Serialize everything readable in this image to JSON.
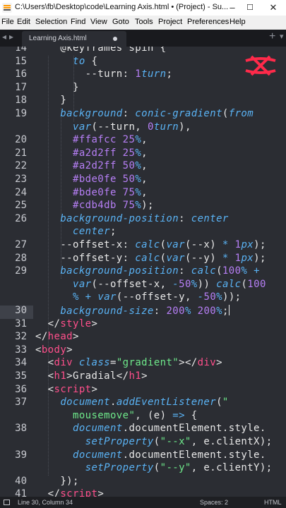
{
  "window": {
    "title": "C:\\Users\\fb\\Desktop\\code\\Learning Axis.html • (Project) - Su...",
    "minimize": "–",
    "maximize": "☐",
    "close": "✕"
  },
  "menu": [
    "File",
    "Edit",
    "Selection",
    "Find",
    "View",
    "Goto",
    "Tools",
    "Project",
    "Preferences",
    "Help"
  ],
  "tabs": {
    "nav_left": "◂",
    "nav_right": "▸",
    "active_label": "Learning Axis.html",
    "new_tab": "+",
    "overflow": "▾"
  },
  "colors": {
    "background": "#2b2d33",
    "text": "#e8e8e8",
    "keyword": "#5ab3f5",
    "selector": "#ff4f8b",
    "string": "#6ee88a",
    "number": "#b67ff5",
    "logo": "#ff2a4a"
  },
  "current_line": 30,
  "editor": {
    "lines": [
      {
        "n": 14,
        "segs": [
          [
            "t",
            "    @keyframes spin {"
          ]
        ]
      },
      {
        "n": 15,
        "segs": [
          [
            "t",
            "      "
          ],
          [
            "k",
            "to"
          ],
          [
            "t",
            " {"
          ]
        ]
      },
      {
        "n": 16,
        "segs": [
          [
            "t",
            "        --turn: "
          ],
          [
            "m",
            "1"
          ],
          [
            "k",
            "turn"
          ],
          [
            "t",
            ";"
          ]
        ]
      },
      {
        "n": 17,
        "segs": [
          [
            "t",
            "      }"
          ]
        ]
      },
      {
        "n": 18,
        "segs": [
          [
            "t",
            "    }"
          ]
        ]
      },
      {
        "n": 19,
        "segs": [
          [
            "t",
            "    "
          ],
          [
            "p",
            "background"
          ],
          [
            "t",
            ": "
          ],
          [
            "k",
            "conic-gradient"
          ],
          [
            "t",
            "("
          ],
          [
            "k",
            "from"
          ]
        ]
      },
      {
        "n": null,
        "segs": [
          [
            "t",
            "      "
          ],
          [
            "k",
            "var"
          ],
          [
            "t",
            "(--turn, "
          ],
          [
            "m",
            "0"
          ],
          [
            "k",
            "turn"
          ],
          [
            "t",
            "),"
          ]
        ]
      },
      {
        "n": 20,
        "segs": [
          [
            "t",
            "      "
          ],
          [
            "m",
            "#ffafcc"
          ],
          [
            "t",
            " "
          ],
          [
            "m",
            "25"
          ],
          [
            "k",
            "%"
          ],
          [
            "t",
            ","
          ]
        ]
      },
      {
        "n": 21,
        "segs": [
          [
            "t",
            "      "
          ],
          [
            "m",
            "#a2d2ff"
          ],
          [
            "t",
            " "
          ],
          [
            "m",
            "25"
          ],
          [
            "k",
            "%"
          ],
          [
            "t",
            ","
          ]
        ]
      },
      {
        "n": 22,
        "segs": [
          [
            "t",
            "      "
          ],
          [
            "m",
            "#a2d2ff"
          ],
          [
            "t",
            " "
          ],
          [
            "m",
            "50"
          ],
          [
            "k",
            "%"
          ],
          [
            "t",
            ","
          ]
        ]
      },
      {
        "n": 23,
        "segs": [
          [
            "t",
            "      "
          ],
          [
            "m",
            "#bde0fe"
          ],
          [
            "t",
            " "
          ],
          [
            "m",
            "50"
          ],
          [
            "k",
            "%"
          ],
          [
            "t",
            ","
          ]
        ]
      },
      {
        "n": 24,
        "segs": [
          [
            "t",
            "      "
          ],
          [
            "m",
            "#bde0fe"
          ],
          [
            "t",
            " "
          ],
          [
            "m",
            "75"
          ],
          [
            "k",
            "%"
          ],
          [
            "t",
            ","
          ]
        ]
      },
      {
        "n": 25,
        "segs": [
          [
            "t",
            "      "
          ],
          [
            "m",
            "#cdb4db"
          ],
          [
            "t",
            " "
          ],
          [
            "m",
            "75"
          ],
          [
            "k",
            "%"
          ],
          [
            "t",
            ");"
          ]
        ]
      },
      {
        "n": 26,
        "segs": [
          [
            "t",
            "    "
          ],
          [
            "p",
            "background-position"
          ],
          [
            "t",
            ": "
          ],
          [
            "k",
            "center"
          ]
        ]
      },
      {
        "n": null,
        "segs": [
          [
            "t",
            "      "
          ],
          [
            "k",
            "center"
          ],
          [
            "t",
            ";"
          ]
        ]
      },
      {
        "n": 27,
        "segs": [
          [
            "t",
            "    --offset-x: "
          ],
          [
            "k",
            "calc"
          ],
          [
            "t",
            "("
          ],
          [
            "k",
            "var"
          ],
          [
            "t",
            "(--x) "
          ],
          [
            "p",
            "*"
          ],
          [
            "t",
            " "
          ],
          [
            "m",
            "1"
          ],
          [
            "k",
            "px"
          ],
          [
            "t",
            ");"
          ]
        ]
      },
      {
        "n": 28,
        "segs": [
          [
            "t",
            "    --offset-y: "
          ],
          [
            "k",
            "calc"
          ],
          [
            "t",
            "("
          ],
          [
            "k",
            "var"
          ],
          [
            "t",
            "(--y) "
          ],
          [
            "p",
            "*"
          ],
          [
            "t",
            " "
          ],
          [
            "m",
            "1"
          ],
          [
            "k",
            "px"
          ],
          [
            "t",
            ");"
          ]
        ]
      },
      {
        "n": 29,
        "segs": [
          [
            "t",
            "    "
          ],
          [
            "p",
            "background-position"
          ],
          [
            "t",
            ": "
          ],
          [
            "k",
            "calc"
          ],
          [
            "t",
            "("
          ],
          [
            "m",
            "100"
          ],
          [
            "k",
            "%"
          ],
          [
            "t",
            " "
          ],
          [
            "p",
            "+"
          ]
        ]
      },
      {
        "n": null,
        "segs": [
          [
            "t",
            "      "
          ],
          [
            "k",
            "var"
          ],
          [
            "t",
            "(--offset-x, "
          ],
          [
            "p",
            "-"
          ],
          [
            "m",
            "50"
          ],
          [
            "k",
            "%"
          ],
          [
            "t",
            ")) "
          ],
          [
            "k",
            "calc"
          ],
          [
            "t",
            "("
          ],
          [
            "m",
            "100"
          ]
        ]
      },
      {
        "n": null,
        "segs": [
          [
            "t",
            "      "
          ],
          [
            "k",
            "%"
          ],
          [
            "t",
            " "
          ],
          [
            "p",
            "+"
          ],
          [
            "t",
            " "
          ],
          [
            "k",
            "var"
          ],
          [
            "t",
            "(--offset-y, "
          ],
          [
            "p",
            "-"
          ],
          [
            "m",
            "50"
          ],
          [
            "k",
            "%"
          ],
          [
            "t",
            "));"
          ]
        ]
      },
      {
        "n": 30,
        "segs": [
          [
            "t",
            "    "
          ],
          [
            "p",
            "background-size"
          ],
          [
            "t",
            ": "
          ],
          [
            "m",
            "200"
          ],
          [
            "k",
            "%"
          ],
          [
            "t",
            " "
          ],
          [
            "m",
            "200"
          ],
          [
            "k",
            "%"
          ],
          [
            "t",
            ";"
          ]
        ]
      },
      {
        "n": 31,
        "segs": [
          [
            "t",
            "  </"
          ],
          [
            "s",
            "style"
          ],
          [
            "t",
            ">"
          ]
        ]
      },
      {
        "n": 32,
        "segs": [
          [
            "t",
            "</"
          ],
          [
            "s",
            "head"
          ],
          [
            "t",
            ">"
          ]
        ]
      },
      {
        "n": 33,
        "segs": [
          [
            "t",
            "<"
          ],
          [
            "s",
            "body"
          ],
          [
            "t",
            ">"
          ]
        ]
      },
      {
        "n": 34,
        "segs": [
          [
            "t",
            "  <"
          ],
          [
            "s",
            "div"
          ],
          [
            "t",
            " "
          ],
          [
            "k",
            "class"
          ],
          [
            "t",
            "="
          ],
          [
            "g",
            "\"gradient\""
          ],
          [
            "t",
            "></"
          ],
          [
            "s",
            "div"
          ],
          [
            "t",
            ">"
          ]
        ]
      },
      {
        "n": 35,
        "segs": [
          [
            "t",
            "  <"
          ],
          [
            "s",
            "h1"
          ],
          [
            "t",
            ">Gradial</"
          ],
          [
            "s",
            "h1"
          ],
          [
            "t",
            ">"
          ]
        ]
      },
      {
        "n": 36,
        "segs": [
          [
            "t",
            "  <"
          ],
          [
            "s",
            "script"
          ],
          [
            "t",
            ">"
          ]
        ]
      },
      {
        "n": 37,
        "segs": [
          [
            "t",
            "    "
          ],
          [
            "k",
            "document"
          ],
          [
            "t",
            "."
          ],
          [
            "k",
            "addEventListener"
          ],
          [
            "t",
            "("
          ],
          [
            "g",
            "\""
          ]
        ]
      },
      {
        "n": null,
        "segs": [
          [
            "t",
            "      "
          ],
          [
            "g",
            "mousemove\""
          ],
          [
            "t",
            ", (e) "
          ],
          [
            "k",
            "=>"
          ],
          [
            "t",
            " {"
          ]
        ]
      },
      {
        "n": 38,
        "segs": [
          [
            "t",
            "      "
          ],
          [
            "k",
            "document"
          ],
          [
            "t",
            ".documentElement.style."
          ]
        ]
      },
      {
        "n": null,
        "segs": [
          [
            "t",
            "        "
          ],
          [
            "k",
            "setProperty"
          ],
          [
            "t",
            "("
          ],
          [
            "g",
            "\"--x\""
          ],
          [
            "t",
            ", e.clientX);"
          ]
        ]
      },
      {
        "n": 39,
        "segs": [
          [
            "t",
            "      "
          ],
          [
            "k",
            "document"
          ],
          [
            "t",
            ".documentElement.style."
          ]
        ]
      },
      {
        "n": null,
        "segs": [
          [
            "t",
            "        "
          ],
          [
            "k",
            "setProperty"
          ],
          [
            "t",
            "("
          ],
          [
            "g",
            "\"--y\""
          ],
          [
            "t",
            ", e.clientY);"
          ]
        ]
      },
      {
        "n": 40,
        "segs": [
          [
            "t",
            "    });"
          ]
        ]
      },
      {
        "n": 41,
        "segs": [
          [
            "t",
            "  </"
          ],
          [
            "s",
            "script"
          ],
          [
            "t",
            ">"
          ]
        ]
      }
    ]
  },
  "status": {
    "position": "Line 30, Column 34",
    "indentation": "Spaces: 2",
    "syntax": "HTML"
  }
}
